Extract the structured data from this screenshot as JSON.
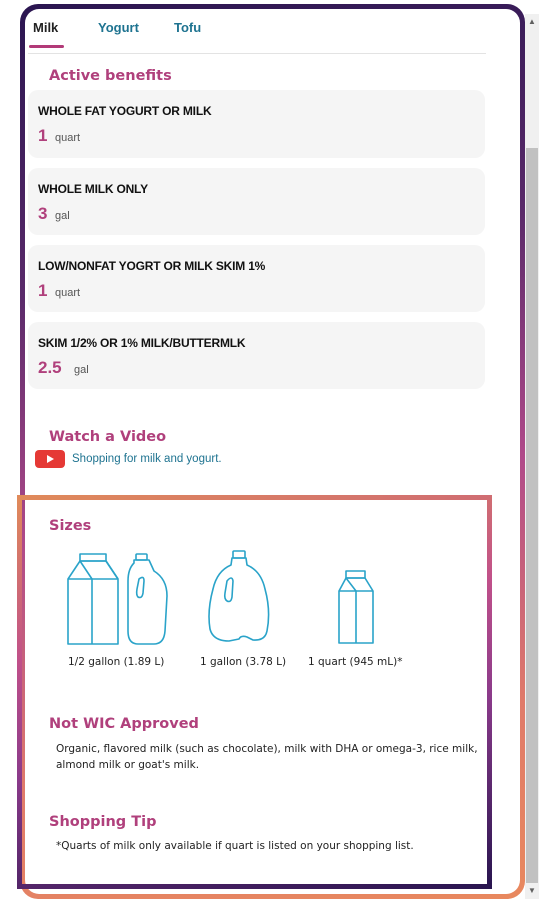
{
  "tabs": [
    {
      "label": "Milk",
      "active": true
    },
    {
      "label": "Yogurt",
      "active": false
    },
    {
      "label": "Tofu",
      "active": false
    }
  ],
  "active_benefits": {
    "heading": "Active benefits",
    "items": [
      {
        "name": "WHOLE FAT YOGURT OR MILK",
        "amount": "1",
        "unit": "quart"
      },
      {
        "name": "WHOLE MILK ONLY",
        "amount": "3",
        "unit": "gal"
      },
      {
        "name": "LOW/NONFAT YOGRT OR MILK SKIM 1%",
        "amount": "1",
        "unit": "quart"
      },
      {
        "name": "SKIM 1/2% OR 1% MILK/BUTTERMLK",
        "amount": "2.5",
        "unit": "gal"
      }
    ]
  },
  "video": {
    "heading": "Watch a Video",
    "link_text": "Shopping for milk and yogurt.",
    "icon": "youtube-play-icon"
  },
  "sizes": {
    "heading": "Sizes",
    "items": [
      {
        "label": "1/2 gallon (1.89 L)",
        "icon": "half-gallon-carton-and-jug-icon"
      },
      {
        "label": "1 gallon (3.78 L)",
        "icon": "gallon-jug-icon"
      },
      {
        "label": "1 quart (945 mL)*",
        "icon": "quart-carton-icon"
      }
    ]
  },
  "not_approved": {
    "heading": "Not WIC Approved",
    "text": "Organic, flavored milk (such as chocolate), milk with DHA or omega-3, rice milk, almond milk or goat's milk."
  },
  "tip": {
    "heading": "Shopping Tip",
    "text": "*Quarts of milk only available if quart is listed on your shopping list."
  },
  "colors": {
    "accent": "#b0407c",
    "link": "#1e7390",
    "youtube": "#e53935"
  }
}
